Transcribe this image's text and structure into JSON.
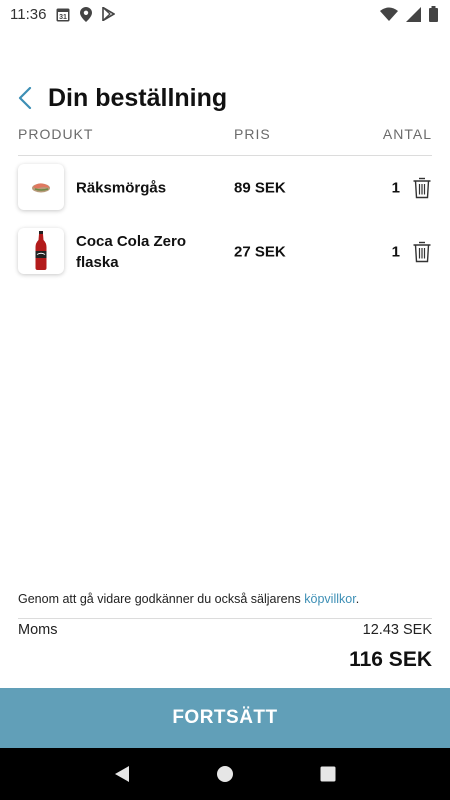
{
  "status_bar": {
    "time": "11:36",
    "calendar_day": "31",
    "icons": [
      "calendar-icon",
      "location-icon",
      "play-store-icon",
      "wifi-icon",
      "cell-signal-icon",
      "battery-icon"
    ]
  },
  "header": {
    "title": "Din beställning"
  },
  "columns": {
    "product": "PRODUKT",
    "price": "PRIS",
    "quantity": "ANTAL"
  },
  "items": [
    {
      "name": "Räksmörgås",
      "price": "89 SEK",
      "quantity": "1",
      "icon": "shrimp-sandwich-image"
    },
    {
      "name": "Coca Cola Zero flaska",
      "price": "27 SEK",
      "quantity": "1",
      "icon": "coca-cola-bottle-image"
    }
  ],
  "footer": {
    "terms_text": "Genom att gå vidare godkänner du också säljarens ",
    "terms_link": "köpvillkor",
    "terms_suffix": ".",
    "moms_label": "Moms",
    "moms_value": "12.43 SEK",
    "total": "116 SEK"
  },
  "continue_label": "FORTSÄTT",
  "colors": {
    "accent": "#619fb8",
    "link": "#3d8fb5",
    "back_arrow": "#3d8fb5"
  }
}
